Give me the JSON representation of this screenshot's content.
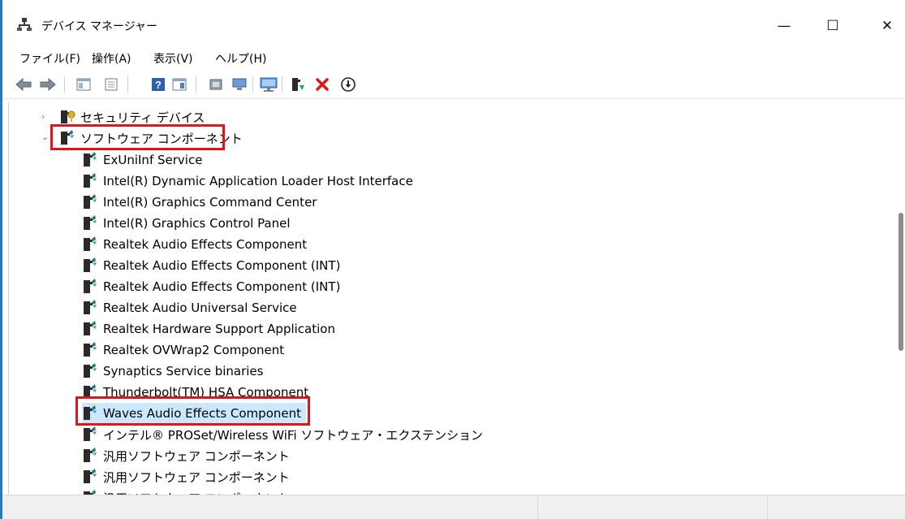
{
  "window": {
    "title": "デバイス マネージャー",
    "controls": {
      "minimize": "—",
      "maximize": "☐",
      "close": "✕"
    }
  },
  "menu": [
    "ファイル(F)",
    "操作(A)",
    "表示(V)",
    "ヘルプ(H)"
  ],
  "toolbar": [
    "back-icon",
    "forward-icon",
    "show-hide-tree-icon",
    "properties-icon",
    "help-icon",
    "action-pane-icon",
    "update-driver-icon",
    "computer-icon",
    "scan-hardware-icon",
    "enable-device-icon",
    "uninstall-icon",
    "download-icon"
  ],
  "tree": {
    "collapsed_category": {
      "label": "セキュリティ デバイス",
      "expander": "›"
    },
    "expanded_category": {
      "label": "ソフトウェア コンポーネント",
      "expander": "⌄"
    },
    "items": [
      "ExUniInf Service",
      "Intel(R) Dynamic Application Loader Host Interface",
      "Intel(R) Graphics Command Center",
      "Intel(R) Graphics Control Panel",
      "Realtek Audio Effects Component",
      "Realtek Audio Effects Component (INT)",
      "Realtek Audio Effects Component (INT)",
      "Realtek Audio Universal Service",
      "Realtek Hardware Support Application",
      "Realtek OVWrap2 Component",
      "Synaptics Service binaries",
      "Thunderbolt(TM) HSA Component",
      "Waves Audio Effects Component",
      "インテル® PROSet/Wireless WiFi ソフトウェア・エクステンション",
      "汎用ソフトウェア コンポーネント",
      "汎用ソフトウェア コンポーネント",
      "汎用ソフトウェア コンポーネント"
    ],
    "selected_item": "Waves Audio Effects Component"
  },
  "colors": {
    "highlight_box": "#e0141b",
    "selection": "#cce8ff",
    "accent": "#2b7bb9"
  }
}
